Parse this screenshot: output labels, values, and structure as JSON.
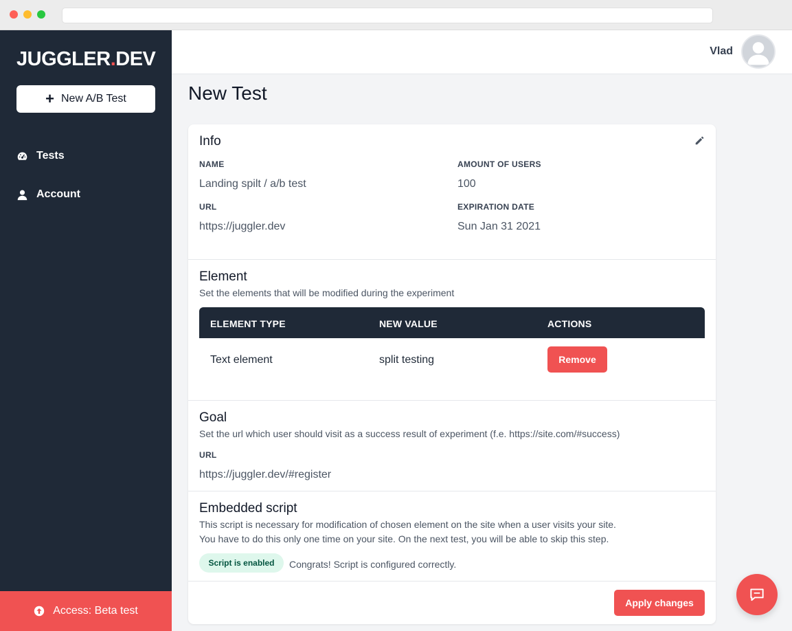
{
  "sidebar": {
    "logo_main": "JUGGLER",
    "logo_dot": ".",
    "logo_suffix": "DEV",
    "new_test_label": "New A/B Test",
    "nav": [
      {
        "label": "Tests",
        "icon": "dashboard-icon"
      },
      {
        "label": "Account",
        "icon": "user-icon"
      }
    ],
    "beta_label": "Access: Beta test"
  },
  "header": {
    "username": "Vlad"
  },
  "page": {
    "title": "New Test"
  },
  "info": {
    "title": "Info",
    "fields": [
      {
        "label": "NAME",
        "value": "Landing spilt / a/b test"
      },
      {
        "label": "AMOUNT OF USERS",
        "value": "100"
      },
      {
        "label": "URL",
        "value": "https://juggler.dev"
      },
      {
        "label": "EXPIRATION DATE",
        "value": "Sun Jan 31 2021"
      }
    ]
  },
  "element": {
    "title": "Element",
    "description": "Set the elements that will be modified during the experiment",
    "columns": [
      "ELEMENT TYPE",
      "NEW VALUE",
      "ACTIONS"
    ],
    "rows": [
      {
        "type": "Text element",
        "value": "split testing",
        "action": "Remove"
      }
    ]
  },
  "goal": {
    "title": "Goal",
    "description": "Set the url which user should visit as a success result of experiment (f.e. https://site.com/#success)",
    "url_label": "URL",
    "url_value": "https://juggler.dev/#register"
  },
  "script": {
    "title": "Embedded script",
    "line1": "This script is necessary for modification of chosen element on the site when a user visits your site.",
    "line2": "You have to do this only one time on your site. On the next test, you will be able to skip this step.",
    "badge": "Script is enabled",
    "status": "Congrats! Script is configured correctly."
  },
  "actions": {
    "apply_label": "Apply changes"
  },
  "colors": {
    "accent": "#f05252",
    "sidebar_bg": "#1f2937"
  }
}
